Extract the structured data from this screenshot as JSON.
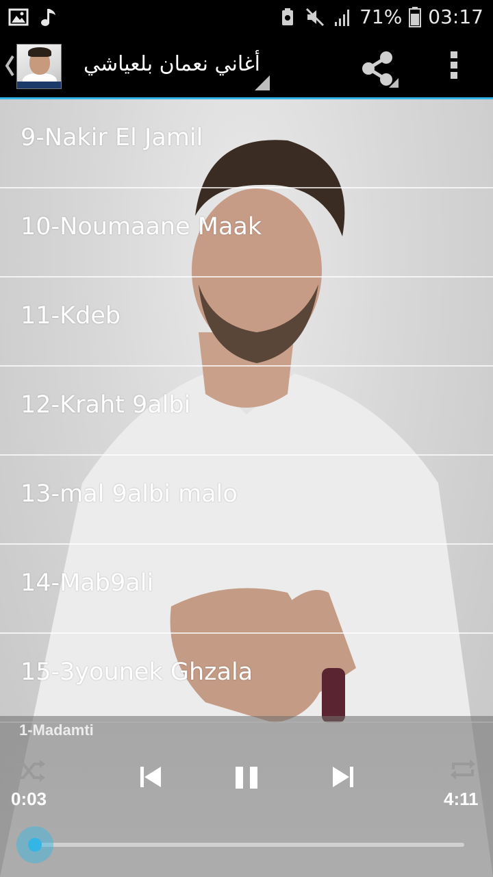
{
  "status_bar": {
    "battery_percent": "71%",
    "time": "03:17",
    "icons": [
      "image-icon",
      "music-note-icon",
      "battery-saver-icon",
      "mute-icon",
      "signal-icon",
      "battery-icon"
    ]
  },
  "action_bar": {
    "title": "أغاني نعمان بلعياشي",
    "back_icon": "chevron-left-icon",
    "share_icon": "share-icon",
    "overflow_icon": "more-vert-icon"
  },
  "songs": [
    {
      "title": "9-Nakir El Jamil"
    },
    {
      "title": "10-Noumaane Maak"
    },
    {
      "title": "11-Kdeb"
    },
    {
      "title": "12-Kraht 9albi"
    },
    {
      "title": "13-mal 9albi malo"
    },
    {
      "title": "14-Mab9ali"
    },
    {
      "title": "15-3younek Ghzala"
    }
  ],
  "player": {
    "now_playing": "1-Madamti",
    "elapsed": "0:03",
    "duration": "4:11",
    "progress_fraction": 0.012,
    "accent_color": "#33b5e5",
    "controls": [
      "shuffle-icon",
      "previous-icon",
      "pause-icon",
      "next-icon",
      "repeat-icon"
    ]
  }
}
